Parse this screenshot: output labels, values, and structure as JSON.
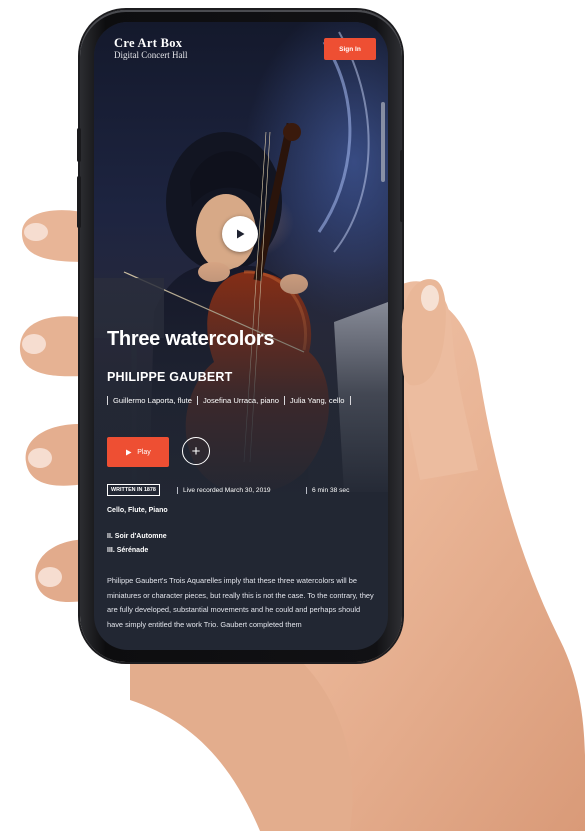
{
  "brand": {
    "name": "Cre Art Box",
    "subtitle": "Digital Concert Hall"
  },
  "header": {
    "signin_label": "Sign In"
  },
  "hero": {
    "play_icon": "play-icon"
  },
  "work": {
    "title": "Three watercolors",
    "composer": "PHILIPPE GAUBERT",
    "performers": [
      "Guillermo Laporta, flute",
      "Josefina Urraca, piano",
      "Julia Yang, cello"
    ],
    "play_label": "Play",
    "add_icon": "plus-icon",
    "written_badge": "WRITTEN IN 1878",
    "recorded": "Live recorded March 30, 2019",
    "duration": "6 min 38 sec",
    "instruments": "Cello, Flute, Piano",
    "movements": [
      "II. Soir d'Automne",
      "III. Sérénade"
    ],
    "description": "Philippe Gaubert's Trois Aquarelles imply that these three watercolors will be miniatures or character pieces, but really this is not the case. To the contrary, they are fully developed, substantial movements and he could and perhaps should have simply entitled the work Trio. Gaubert completed them"
  },
  "colors": {
    "accent": "#ee4f33",
    "background": "#222733",
    "text": "#ffffff"
  }
}
